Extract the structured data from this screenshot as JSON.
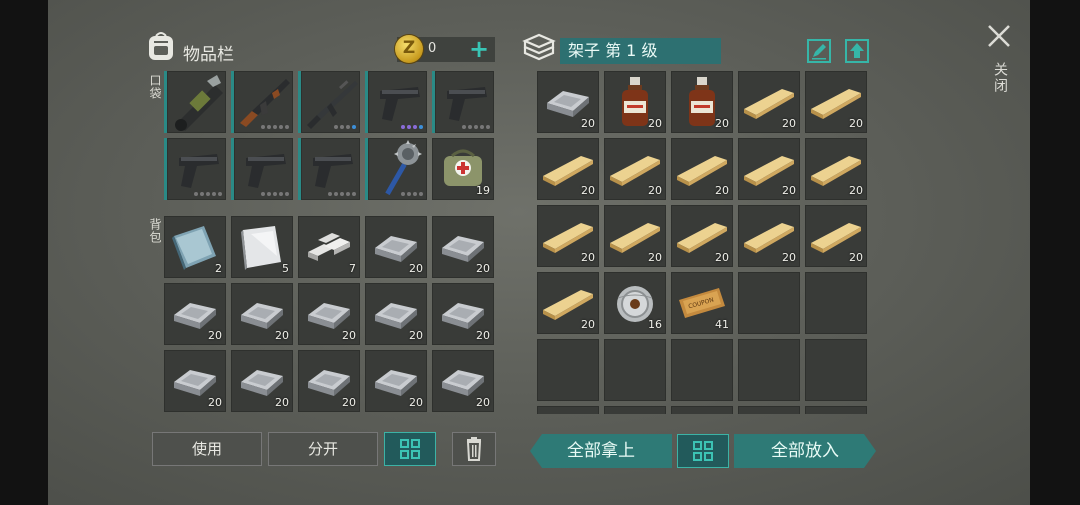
{
  "inventory": {
    "title": "物品栏",
    "coins": "0",
    "pocket_label": "口袋",
    "backpack_label": "背包",
    "pocket_slots": [
      {
        "item": "rocket-launcher-icon",
        "dots": []
      },
      {
        "item": "assault-rifle-icon",
        "dots": [
          "grey",
          "grey",
          "grey",
          "grey",
          "grey"
        ]
      },
      {
        "item": "rifle-icon",
        "dots": [
          "grey",
          "grey",
          "grey",
          "blue"
        ]
      },
      {
        "item": "pistol-icon",
        "dots": [
          "purple",
          "purple",
          "purple",
          "blue"
        ]
      },
      {
        "item": "pistol-icon",
        "dots": [
          "grey",
          "grey",
          "grey",
          "grey",
          "grey"
        ]
      },
      {
        "item": "pistol-icon",
        "dots": [
          "grey",
          "grey",
          "grey",
          "grey",
          "grey"
        ]
      },
      {
        "item": "pistol-icon",
        "dots": [
          "grey",
          "grey",
          "grey",
          "grey",
          "grey"
        ]
      },
      {
        "item": "pistol-icon",
        "dots": [
          "grey",
          "grey",
          "grey",
          "grey",
          "grey"
        ]
      },
      {
        "item": "spiked-mace-icon",
        "dots": [
          "grey",
          "grey",
          "grey",
          "grey"
        ]
      },
      {
        "item": "medkit-bag-icon",
        "qty": "19"
      }
    ],
    "backpack_slots": [
      {
        "item": "metal-plate-icon",
        "qty": "2"
      },
      {
        "item": "steel-sheet-icon",
        "qty": "5"
      },
      {
        "item": "aluminum-bars-icon",
        "qty": "7"
      },
      {
        "item": "iron-ingot-icon",
        "qty": "20"
      },
      {
        "item": "iron-ingot-icon",
        "qty": "20"
      },
      {
        "item": "iron-ingot-icon",
        "qty": "20"
      },
      {
        "item": "iron-ingot-icon",
        "qty": "20"
      },
      {
        "item": "iron-ingot-icon",
        "qty": "20"
      },
      {
        "item": "iron-ingot-icon",
        "qty": "20"
      },
      {
        "item": "iron-ingot-icon",
        "qty": "20"
      },
      {
        "item": "iron-ingot-icon",
        "qty": "20"
      },
      {
        "item": "iron-ingot-icon",
        "qty": "20"
      },
      {
        "item": "iron-ingot-icon",
        "qty": "20"
      },
      {
        "item": "iron-ingot-icon",
        "qty": "20"
      },
      {
        "item": "iron-ingot-icon",
        "qty": "20"
      }
    ],
    "buttons": {
      "use": "使用",
      "split": "分开"
    }
  },
  "shelf": {
    "title": "架子 第 1 级",
    "slots": [
      {
        "item": "iron-ingot-icon",
        "qty": "20"
      },
      {
        "item": "alcohol-bottle-icon",
        "qty": "20"
      },
      {
        "item": "alcohol-bottle-icon",
        "qty": "20"
      },
      {
        "item": "wood-plank-icon",
        "qty": "20"
      },
      {
        "item": "wood-plank-icon",
        "qty": "20"
      },
      {
        "item": "wood-plank-icon",
        "qty": "20"
      },
      {
        "item": "wood-plank-icon",
        "qty": "20"
      },
      {
        "item": "wood-plank-icon",
        "qty": "20"
      },
      {
        "item": "wood-plank-icon",
        "qty": "20"
      },
      {
        "item": "wood-plank-icon",
        "qty": "20"
      },
      {
        "item": "wood-plank-icon",
        "qty": "20"
      },
      {
        "item": "wood-plank-icon",
        "qty": "20"
      },
      {
        "item": "wood-plank-icon",
        "qty": "20"
      },
      {
        "item": "wood-plank-icon",
        "qty": "20"
      },
      {
        "item": "wood-plank-icon",
        "qty": "20"
      },
      {
        "item": "wood-plank-icon",
        "qty": "20"
      },
      {
        "item": "wire-spool-icon",
        "qty": "16"
      },
      {
        "item": "coupon-icon",
        "qty": "41",
        "text": "COUPON"
      },
      {
        "item": ""
      },
      {
        "item": ""
      },
      {
        "item": ""
      },
      {
        "item": ""
      },
      {
        "item": ""
      },
      {
        "item": ""
      },
      {
        "item": ""
      },
      {
        "item": ""
      },
      {
        "item": ""
      },
      {
        "item": ""
      },
      {
        "item": ""
      },
      {
        "item": ""
      }
    ],
    "buttons": {
      "take_all": "全部拿上",
      "put_all": "全部放入"
    }
  },
  "close_label": "关闭",
  "colors": {
    "accent": "#36b6a8",
    "panel": "#393b38",
    "background": "#5d5f59"
  }
}
